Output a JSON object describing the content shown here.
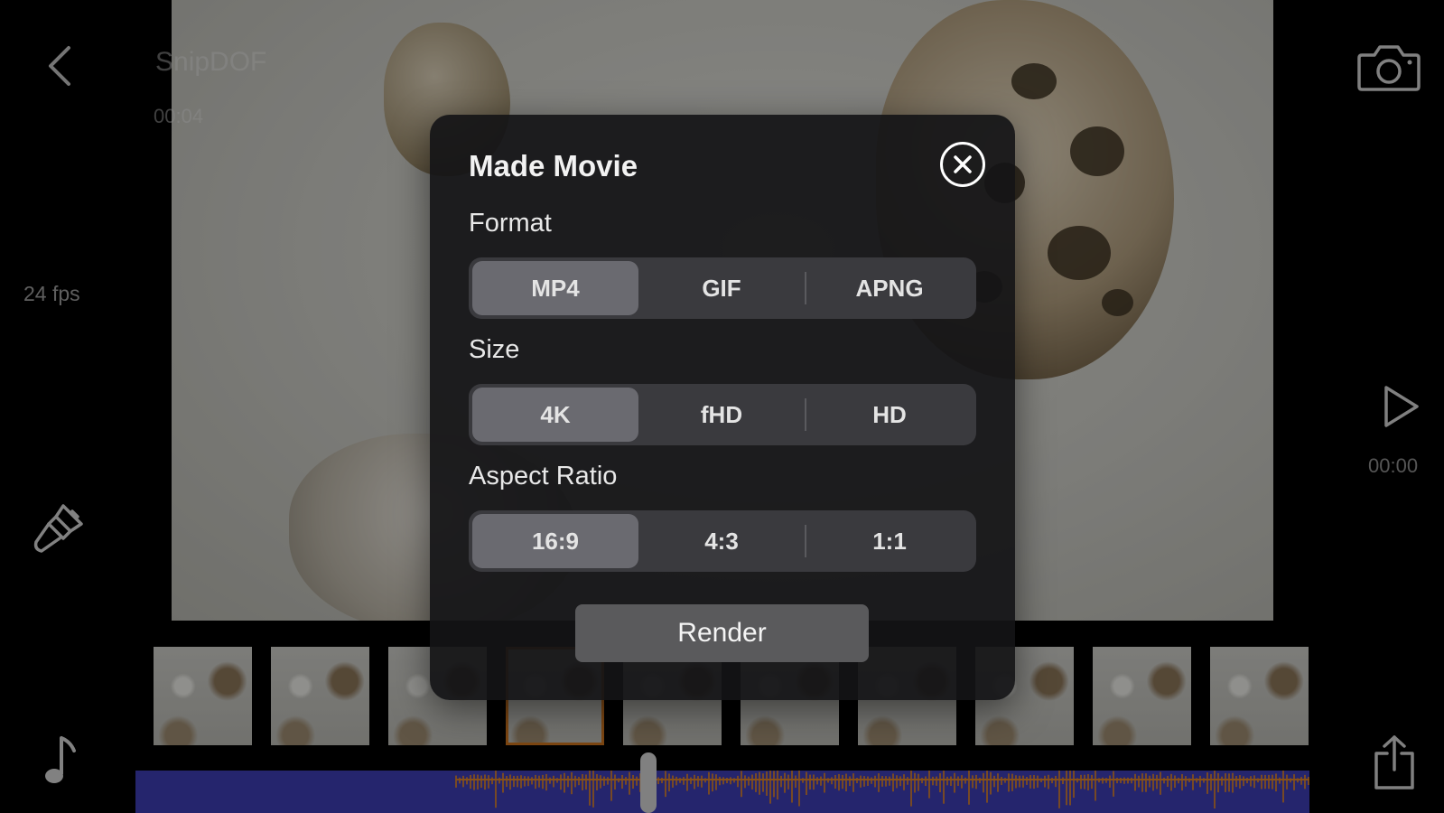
{
  "project": {
    "title": "SnipDOF",
    "duration": "00:04"
  },
  "toolbar": {
    "fps": "24 fps",
    "time": "00:00"
  },
  "icons": {
    "back": "chevron-left-icon",
    "camera": "camera-icon",
    "brush": "brush-icon",
    "music": "music-note-icon",
    "play": "play-icon",
    "share": "share-icon",
    "close": "close-icon"
  },
  "modal": {
    "title": "Made Movie",
    "format": {
      "label": "Format",
      "options": [
        "MP4",
        "GIF",
        "APNG"
      ],
      "selected": "MP4"
    },
    "size": {
      "label": "Size",
      "options": [
        "4K",
        "fHD",
        "HD"
      ],
      "selected": "4K"
    },
    "aspect": {
      "label": "Aspect Ratio",
      "options": [
        "16:9",
        "4:3",
        "1:1"
      ],
      "selected": "16:9"
    },
    "render_label": "Render"
  },
  "timeline": {
    "frame_count": 10,
    "selected_frame": 4
  },
  "colors": {
    "accent": "#c9721e",
    "audio_track": "#3c3cb0",
    "waveform": "#d9812a"
  }
}
